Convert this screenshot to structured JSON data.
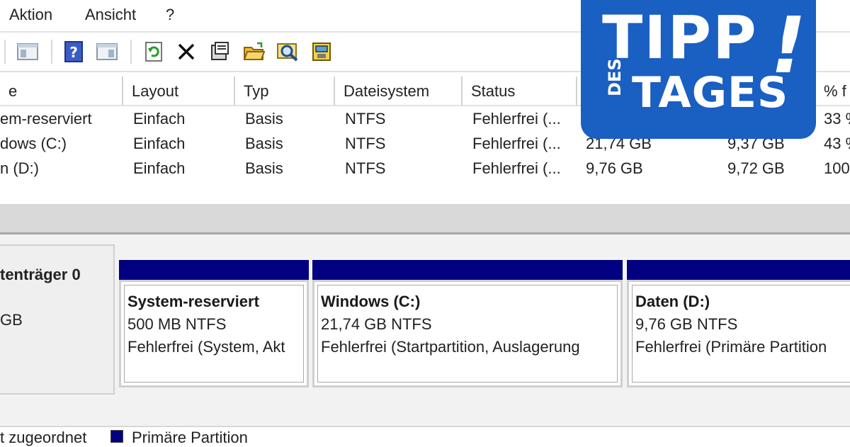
{
  "menu": {
    "items": [
      "Aktion",
      "Ansicht",
      "?"
    ]
  },
  "toolbar": {
    "icons": [
      "back-partial-icon",
      "console-tree-icon",
      "help-icon",
      "action-pane-icon",
      "refresh-icon",
      "delete-icon",
      "properties-icon",
      "open-icon",
      "search-icon",
      "disk-settings-icon"
    ]
  },
  "table": {
    "headers": [
      "e",
      "Layout",
      "Typ",
      "Dateisystem",
      "Status",
      "",
      "",
      "% f"
    ],
    "rows": [
      {
        "name": "em-reserviert",
        "layout": "Einfach",
        "type": "Basis",
        "fs": "NTFS",
        "status": "Fehlerfrei (...",
        "capacity": "",
        "free": "",
        "pct": "33 %"
      },
      {
        "name": "dows (C:)",
        "layout": "Einfach",
        "type": "Basis",
        "fs": "NTFS",
        "status": "Fehlerfrei (...",
        "capacity": "21,74 GB",
        "free": "9,37 GB",
        "pct": "43 %"
      },
      {
        "name": "n (D:)",
        "layout": "Einfach",
        "type": "Basis",
        "fs": "NTFS",
        "status": "Fehlerfrei (...",
        "capacity": "9,76 GB",
        "free": "9,72 GB",
        "pct": "100"
      }
    ]
  },
  "disk": {
    "label": "tenträger 0",
    "size": "GB",
    "partitions": [
      {
        "name": "System-reserviert",
        "size": "500 MB NTFS",
        "status": "Fehlerfrei (System, Akt"
      },
      {
        "name": "Windows  (C:)",
        "size": "21,74 GB NTFS",
        "status": "Fehlerfrei (Startpartition, Auslagerung"
      },
      {
        "name": "Daten  (D:)",
        "size": "9,76 GB NTFS",
        "status": "Fehlerfrei (Primäre Partition"
      }
    ]
  },
  "legend": {
    "unallocated": "t zugeordnet",
    "primary": "Primäre Partition"
  },
  "badge": {
    "line1": "TIPP",
    "exclaim": "!",
    "small": "DES",
    "line2": "TAGES",
    "color": "#1a5fc2"
  },
  "colors": {
    "primary_partition": "#000080"
  }
}
